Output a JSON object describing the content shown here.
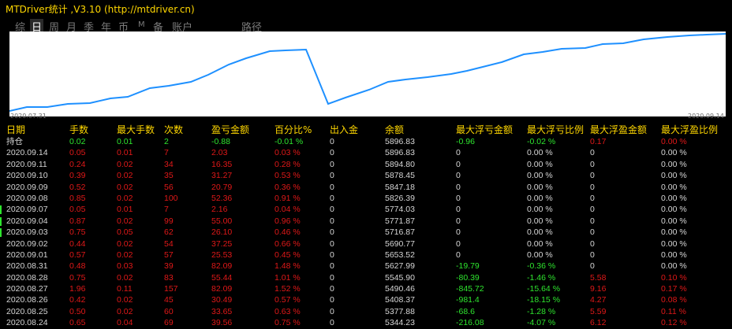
{
  "app": {
    "title": "MTDriver统计 ,V3.10 (http://mtdriver.cn)"
  },
  "tabs": [
    "综",
    "日",
    "周",
    "月",
    "季",
    "年",
    "币",
    "M",
    "备",
    "账户",
    "路径"
  ],
  "active_tab": "日",
  "chart": {
    "start_date": "2020.07.31",
    "end_date": "2020.09.14",
    "line_color": "#1E90FF"
  },
  "columns": [
    "日期",
    "手数",
    "最大手数",
    "次数",
    "盈亏金额",
    "百分比%",
    "出入金",
    "余额",
    "最大浮亏金额",
    "最大浮亏比例",
    "最大浮盈金额",
    "最大浮盈比例"
  ],
  "rows": [
    {
      "date": "持仓",
      "lots": "0.02",
      "max_lots": "0.01",
      "count": "2",
      "pnl": "-0.88",
      "pct": "-0.01 %",
      "io": "0",
      "balance": "5896.83",
      "float_loss": "-0.96",
      "float_loss_pct": "-0.02 %",
      "float_profit": "0.17",
      "float_profit_pct": "0.00 %"
    },
    {
      "date": "2020.09.14",
      "lots": "0.05",
      "max_lots": "0.01",
      "count": "7",
      "pnl": "2.03",
      "pct": "0.03 %",
      "io": "0",
      "balance": "5896.83",
      "float_loss": "0",
      "float_loss_pct": "0.00 %",
      "float_profit": "0",
      "float_profit_pct": "0.00 %"
    },
    {
      "date": "2020.09.11",
      "lots": "0.24",
      "max_lots": "0.02",
      "count": "34",
      "pnl": "16.35",
      "pct": "0.28 %",
      "io": "0",
      "balance": "5894.80",
      "float_loss": "0",
      "float_loss_pct": "0.00 %",
      "float_profit": "0",
      "float_profit_pct": "0.00 %"
    },
    {
      "date": "2020.09.10",
      "lots": "0.39",
      "max_lots": "0.02",
      "count": "35",
      "pnl": "31.27",
      "pct": "0.53 %",
      "io": "0",
      "balance": "5878.45",
      "float_loss": "0",
      "float_loss_pct": "0.00 %",
      "float_profit": "0",
      "float_profit_pct": "0.00 %"
    },
    {
      "date": "2020.09.09",
      "lots": "0.52",
      "max_lots": "0.02",
      "count": "56",
      "pnl": "20.79",
      "pct": "0.36 %",
      "io": "0",
      "balance": "5847.18",
      "float_loss": "0",
      "float_loss_pct": "0.00 %",
      "float_profit": "0",
      "float_profit_pct": "0.00 %"
    },
    {
      "date": "2020.09.08",
      "lots": "0.85",
      "max_lots": "0.02",
      "count": "100",
      "pnl": "52.36",
      "pct": "0.91 %",
      "io": "0",
      "balance": "5826.39",
      "float_loss": "0",
      "float_loss_pct": "0.00 %",
      "float_profit": "0",
      "float_profit_pct": "0.00 %"
    },
    {
      "date": "2020.09.07",
      "lots": "0.05",
      "max_lots": "0.01",
      "count": "7",
      "pnl": "2.16",
      "pct": "0.04 %",
      "io": "0",
      "balance": "5774.03",
      "float_loss": "0",
      "float_loss_pct": "0.00 %",
      "float_profit": "0",
      "float_profit_pct": "0.00 %"
    },
    {
      "date": "2020.09.04",
      "lots": "0.87",
      "max_lots": "0.02",
      "count": "99",
      "pnl": "55.00",
      "pct": "0.96 %",
      "io": "0",
      "balance": "5771.87",
      "float_loss": "0",
      "float_loss_pct": "0.00 %",
      "float_profit": "0",
      "float_profit_pct": "0.00 %"
    },
    {
      "date": "2020.09.03",
      "lots": "0.75",
      "max_lots": "0.05",
      "count": "62",
      "pnl": "26.10",
      "pct": "0.46 %",
      "io": "0",
      "balance": "5716.87",
      "float_loss": "0",
      "float_loss_pct": "0.00 %",
      "float_profit": "0",
      "float_profit_pct": "0.00 %"
    },
    {
      "date": "2020.09.02",
      "lots": "0.44",
      "max_lots": "0.02",
      "count": "54",
      "pnl": "37.25",
      "pct": "0.66 %",
      "io": "0",
      "balance": "5690.77",
      "float_loss": "0",
      "float_loss_pct": "0.00 %",
      "float_profit": "0",
      "float_profit_pct": "0.00 %"
    },
    {
      "date": "2020.09.01",
      "lots": "0.57",
      "max_lots": "0.02",
      "count": "57",
      "pnl": "25.53",
      "pct": "0.45 %",
      "io": "0",
      "balance": "5653.52",
      "float_loss": "0",
      "float_loss_pct": "0.00 %",
      "float_profit": "0",
      "float_profit_pct": "0.00 %"
    },
    {
      "date": "2020.08.31",
      "lots": "0.48",
      "max_lots": "0.03",
      "count": "39",
      "pnl": "82.09",
      "pct": "1.48 %",
      "io": "0",
      "balance": "5627.99",
      "float_loss": "-19.79",
      "float_loss_pct": "-0.36 %",
      "float_profit": "0",
      "float_profit_pct": "0.00 %"
    },
    {
      "date": "2020.08.28",
      "lots": "0.75",
      "max_lots": "0.02",
      "count": "83",
      "pnl": "55.44",
      "pct": "1.01 %",
      "io": "0",
      "balance": "5545.90",
      "float_loss": "-80.39",
      "float_loss_pct": "-1.46 %",
      "float_profit": "5.58",
      "float_profit_pct": "0.10 %"
    },
    {
      "date": "2020.08.27",
      "lots": "1.96",
      "max_lots": "0.11",
      "count": "157",
      "pnl": "82.09",
      "pct": "1.52 %",
      "io": "0",
      "balance": "5490.46",
      "float_loss": "-845.72",
      "float_loss_pct": "-15.64 %",
      "float_profit": "9.16",
      "float_profit_pct": "0.17 %"
    },
    {
      "date": "2020.08.26",
      "lots": "0.42",
      "max_lots": "0.02",
      "count": "45",
      "pnl": "30.49",
      "pct": "0.57 %",
      "io": "0",
      "balance": "5408.37",
      "float_loss": "-981.4",
      "float_loss_pct": "-18.15 %",
      "float_profit": "4.27",
      "float_profit_pct": "0.08 %"
    },
    {
      "date": "2020.08.25",
      "lots": "0.50",
      "max_lots": "0.02",
      "count": "60",
      "pnl": "33.65",
      "pct": "0.63 %",
      "io": "0",
      "balance": "5377.88",
      "float_loss": "-68.6",
      "float_loss_pct": "-1.28 %",
      "float_profit": "5.59",
      "float_profit_pct": "0.11 %"
    },
    {
      "date": "2020.08.24",
      "lots": "0.65",
      "max_lots": "0.04",
      "count": "69",
      "pnl": "39.56",
      "pct": "0.75 %",
      "io": "0",
      "balance": "5344.23",
      "float_loss": "-216.08",
      "float_loss_pct": "-4.07 %",
      "float_profit": "6.12",
      "float_profit_pct": "0.12 %"
    }
  ],
  "colors": {
    "title": "#FFD700",
    "header": "#FFD700",
    "text": "#D6D6D6",
    "negative": "#2EE52E",
    "positive": "#E01818",
    "chart_bg": "#FFFFFF",
    "chart_line": "#1E90FF"
  }
}
